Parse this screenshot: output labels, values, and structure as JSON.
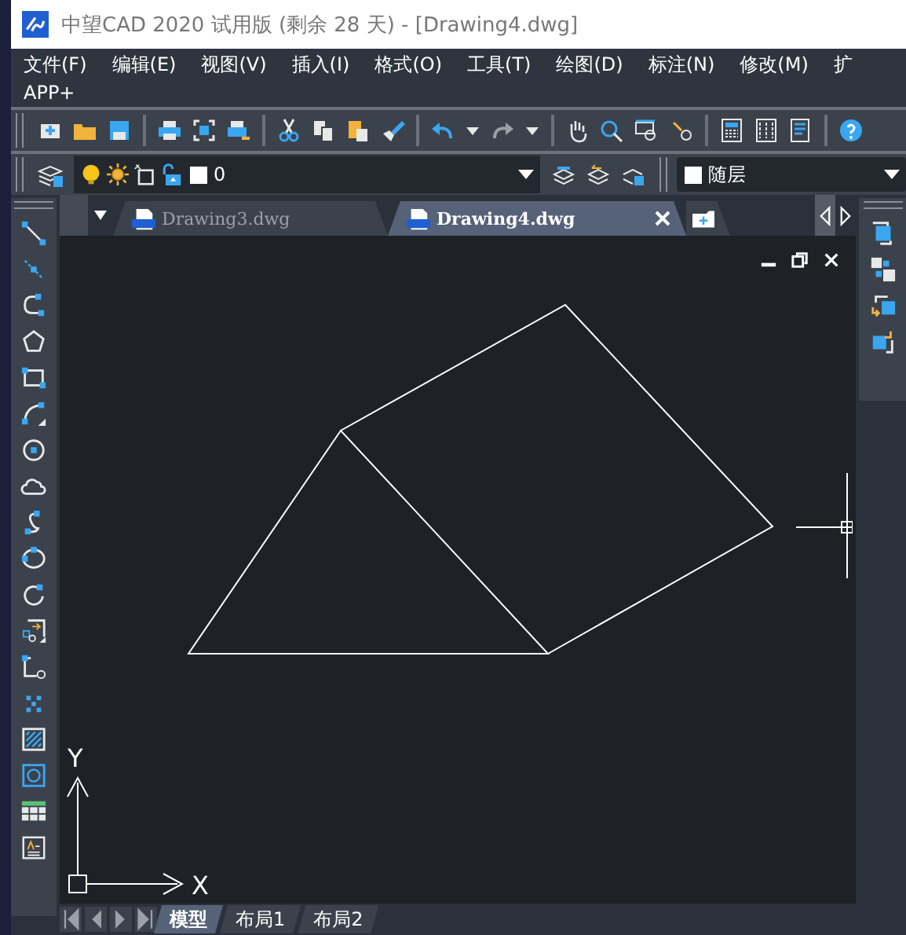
{
  "window": {
    "title": "中望CAD 2020 试用版 (剩余 28 天) - [Drawing4.dwg]"
  },
  "menu_rows": [
    [
      "文件(F)",
      "编辑(E)",
      "视图(V)",
      "插入(I)",
      "格式(O)",
      "工具(T)",
      "绘图(D)",
      "标注(N)",
      "修改(M)",
      "扩"
    ],
    [
      "APP+"
    ]
  ],
  "layer_bar": {
    "layer": "0",
    "color_control": "随层"
  },
  "tabs": [
    {
      "label": "Drawing3.dwg",
      "selected": false
    },
    {
      "label": "Drawing4.dwg",
      "selected": true
    }
  ],
  "ucs": {
    "x_label": "X",
    "y_label": "Y"
  },
  "layout_tabs": [
    {
      "label": "模型",
      "selected": true
    },
    {
      "label": "布局1",
      "selected": false
    },
    {
      "label": "布局2",
      "selected": false
    }
  ]
}
